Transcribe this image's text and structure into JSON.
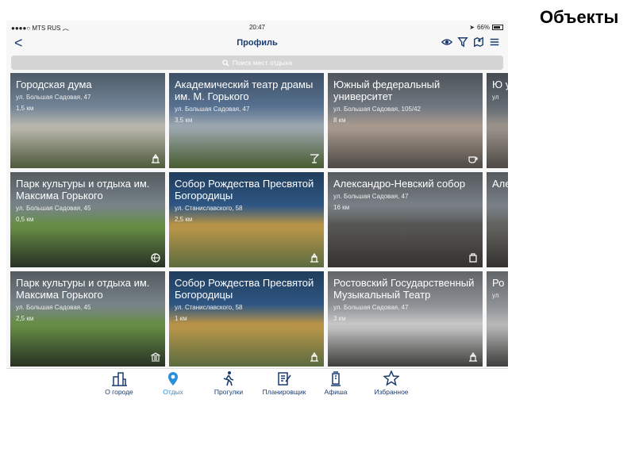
{
  "caption": "Объекты",
  "status": {
    "carrier": "MTS RUS",
    "time": "20:47",
    "battery": "66%"
  },
  "nav": {
    "back": "<",
    "title": "Профиль"
  },
  "search": {
    "placeholder": "Поиск мест отдыха"
  },
  "tiles": [
    {
      "title": "Городская дума",
      "addr": "ул. Большая Садовая, 47",
      "dist": "1,5 км",
      "icon": "monument-icon",
      "colors": [
        "#8fa7bf",
        "#c9c6bd",
        "#5a6a45"
      ]
    },
    {
      "title": "Академический театр драмы им. М. Горького",
      "addr": "ул. Большая Садовая, 47",
      "dist": "3,5 км",
      "icon": "cocktail-icon",
      "colors": [
        "#6f90b8",
        "#a9b4bf",
        "#556b3a"
      ]
    },
    {
      "title": "Южный федеральный университет",
      "addr": "ул. Большая Садовая, 105/42",
      "dist": "8 км",
      "icon": "coffee-icon",
      "colors": [
        "#8e98a4",
        "#b7a79a",
        "#5c5652"
      ]
    },
    {
      "title": "Ю у",
      "addr": "ул",
      "dist": "",
      "icon": "",
      "colors": [
        "#7d8792",
        "#a89f96",
        "#5c5652"
      ]
    },
    {
      "title": "Парк культуры и отдыха им. Максима Горького",
      "addr": "ул. Большая Садовая, 45",
      "dist": "0,5 км",
      "icon": "ball-icon",
      "colors": [
        "#99a7b0",
        "#6f9a4a",
        "#2f3b2a"
      ]
    },
    {
      "title": "Собор Рождества Пресвятой Богородицы",
      "addr": "ул. Станиславского, 58",
      "dist": "2,5 км",
      "icon": "monument-icon",
      "colors": [
        "#3b6fa8",
        "#c9a04c",
        "#6c7e4a"
      ]
    },
    {
      "title": "Александро-Невский собор",
      "addr": "ул. Большая Садовая, 47",
      "dist": "16 км",
      "icon": "bag-icon",
      "colors": [
        "#9aa3ab",
        "#5d5d5a",
        "#3e3b38"
      ]
    },
    {
      "title": "Але",
      "addr": "",
      "dist": "",
      "icon": "",
      "colors": [
        "#9aa3ab",
        "#6a6a66",
        "#3e3b38"
      ]
    },
    {
      "title": "Парк культуры и отдыха им. Максима Горького",
      "addr": "ул. Большая Садовая, 45",
      "dist": "2,5 км",
      "icon": "museum-icon",
      "colors": [
        "#99a7b0",
        "#6f9a4a",
        "#2f3b2a"
      ]
    },
    {
      "title": "Собор Рождества Пресвятой Богородицы",
      "addr": "ул. Станиславского, 58",
      "dist": "1 км",
      "icon": "monument-icon",
      "colors": [
        "#3b6fa8",
        "#c9a04c",
        "#6c7e4a"
      ]
    },
    {
      "title": "Ростовский Государственный Музыкальный Театр",
      "addr": "ул. Большая Садовая, 47",
      "dist": "3 км",
      "icon": "monument-icon",
      "colors": [
        "#b3b8bd",
        "#d9d9d9",
        "#4a4a48"
      ]
    },
    {
      "title": "Ро Му",
      "addr": "ул",
      "dist": "",
      "icon": "",
      "colors": [
        "#b3b8bd",
        "#c8c8c8",
        "#4a4a48"
      ]
    }
  ],
  "tabs": [
    {
      "label": "О городе",
      "icon": "city-icon"
    },
    {
      "label": "Отдых",
      "icon": "location-pin-icon",
      "active": true
    },
    {
      "label": "Прогулки",
      "icon": "walker-icon"
    },
    {
      "label": "Планировщик",
      "icon": "planner-icon"
    },
    {
      "label": "Афиша",
      "icon": "poster-column-icon"
    },
    {
      "label": "Избранное",
      "icon": "star-icon"
    }
  ]
}
